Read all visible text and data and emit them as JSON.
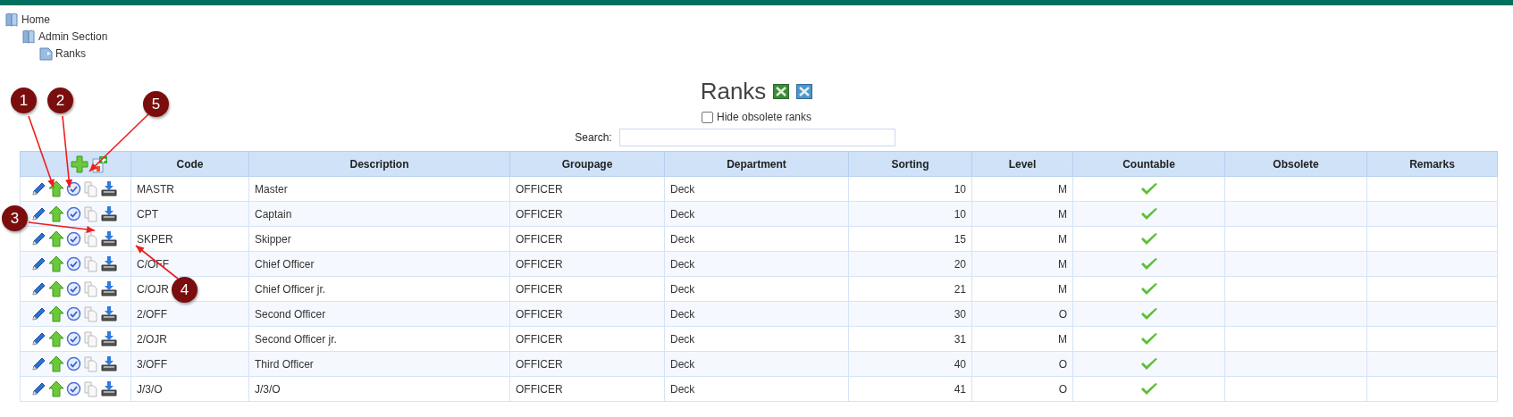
{
  "tree": [
    {
      "label": "Home",
      "children": [
        {
          "label": "Admin Section",
          "children": [
            {
              "label": "Ranks"
            }
          ]
        }
      ]
    }
  ],
  "title": "Ranks",
  "hide_obsolete": {
    "label": "Hide obsolete ranks",
    "checked": false
  },
  "search": {
    "label": "Search:"
  },
  "table": {
    "columns": [
      "Code",
      "Description",
      "Groupage",
      "Department",
      "Sorting",
      "Level",
      "Countable",
      "Obsolete",
      "Remarks"
    ],
    "rows": [
      {
        "code": "MASTR",
        "description": "Master",
        "groupage": "OFFICER",
        "department": "Deck",
        "sorting": "10",
        "level": "M",
        "countable": true
      },
      {
        "code": "CPT",
        "description": "Captain",
        "groupage": "OFFICER",
        "department": "Deck",
        "sorting": "10",
        "level": "M",
        "countable": true
      },
      {
        "code": "SKPER",
        "description": "Skipper",
        "groupage": "OFFICER",
        "department": "Deck",
        "sorting": "15",
        "level": "M",
        "countable": true
      },
      {
        "code": "C/OFF",
        "description": "Chief Officer",
        "groupage": "OFFICER",
        "department": "Deck",
        "sorting": "20",
        "level": "M",
        "countable": true
      },
      {
        "code": "C/OJR",
        "description": "Chief Officer jr.",
        "groupage": "OFFICER",
        "department": "Deck",
        "sorting": "21",
        "level": "M",
        "countable": true
      },
      {
        "code": "2/OFF",
        "description": "Second Officer",
        "groupage": "OFFICER",
        "department": "Deck",
        "sorting": "30",
        "level": "O",
        "countable": true
      },
      {
        "code": "2/OJR",
        "description": "Second Officer jr.",
        "groupage": "OFFICER",
        "department": "Deck",
        "sorting": "31",
        "level": "M",
        "countable": true
      },
      {
        "code": "3/OFF",
        "description": "Third Officer",
        "groupage": "OFFICER",
        "department": "Deck",
        "sorting": "40",
        "level": "O",
        "countable": true
      },
      {
        "code": "J/3/O",
        "description": "J/3/O",
        "groupage": "OFFICER",
        "department": "Deck",
        "sorting": "41",
        "level": "O",
        "countable": true
      }
    ]
  },
  "annotations": [
    {
      "number": "1"
    },
    {
      "number": "2"
    },
    {
      "number": "5"
    },
    {
      "number": "3"
    },
    {
      "number": "4"
    }
  ]
}
